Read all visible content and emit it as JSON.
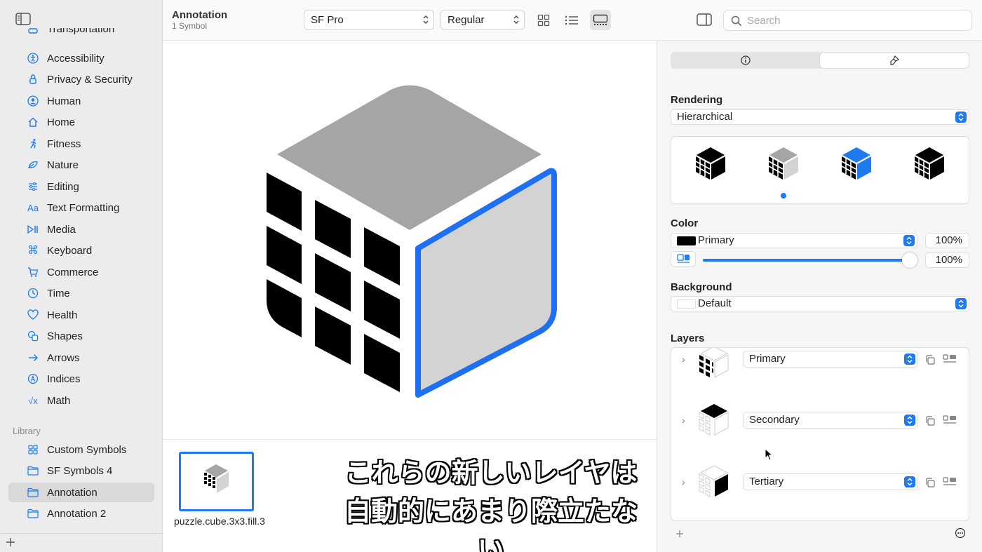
{
  "window": {
    "title": "Annotation",
    "subtitle": "1 Symbol"
  },
  "toolbar": {
    "font_popup": "SF Pro",
    "weight_popup": "Regular",
    "search_placeholder": "Search"
  },
  "sidebar": {
    "categories": [
      {
        "label": "Transportation",
        "icon": "car-icon"
      },
      {
        "label": "Accessibility",
        "icon": "accessibility-icon"
      },
      {
        "label": "Privacy & Security",
        "icon": "lock-icon"
      },
      {
        "label": "Human",
        "icon": "person-icon"
      },
      {
        "label": "Home",
        "icon": "house-icon"
      },
      {
        "label": "Fitness",
        "icon": "running-figure-icon"
      },
      {
        "label": "Nature",
        "icon": "leaf-icon"
      },
      {
        "label": "Editing",
        "icon": "sliders-icon"
      },
      {
        "label": "Text Formatting",
        "icon": "textformat-icon"
      },
      {
        "label": "Media",
        "icon": "play-pause-icon"
      },
      {
        "label": "Keyboard",
        "icon": "command-icon"
      },
      {
        "label": "Commerce",
        "icon": "cart-icon"
      },
      {
        "label": "Time",
        "icon": "clock-icon"
      },
      {
        "label": "Health",
        "icon": "heart-icon"
      },
      {
        "label": "Shapes",
        "icon": "shapes-icon"
      },
      {
        "label": "Arrows",
        "icon": "arrow-right-icon"
      },
      {
        "label": "Indices",
        "icon": "circle-a-icon"
      },
      {
        "label": "Math",
        "icon": "square-root-icon"
      }
    ],
    "library_header": "Library",
    "library": [
      {
        "label": "Custom Symbols",
        "icon": "grid-icon",
        "selected": false
      },
      {
        "label": "SF Symbols 4",
        "icon": "folder-icon",
        "selected": false
      },
      {
        "label": "Annotation",
        "icon": "folder-icon",
        "selected": true
      },
      {
        "label": "Annotation 2",
        "icon": "folder-icon",
        "selected": false
      }
    ]
  },
  "gallery": {
    "symbol_name": "puzzle.cube.3x3.fill.3",
    "subtitle_line1": "これらの新しいレイヤは",
    "subtitle_line2": "自動的にあまり際立たない"
  },
  "inspector": {
    "rendering_title": "Rendering",
    "rendering_value": "Hierarchical",
    "rendering_modes": [
      "monochrome",
      "hierarchical",
      "palette",
      "multicolor"
    ],
    "selected_mode_index": 1,
    "color_title": "Color",
    "color_value": "Primary",
    "color_opacity": "100%",
    "slider_opacity": "100%",
    "slider_level": 1.0,
    "background_title": "Background",
    "background_value": "Default",
    "layers_title": "Layers",
    "layers": [
      {
        "level": "Primary"
      },
      {
        "level": "Secondary"
      },
      {
        "level": "Tertiary"
      }
    ]
  },
  "colors": {
    "accent": "#1f7aef",
    "primary": "#000000",
    "secondary_gray": "#a4a5a6",
    "tertiary_gray": "#d3d3d4"
  }
}
